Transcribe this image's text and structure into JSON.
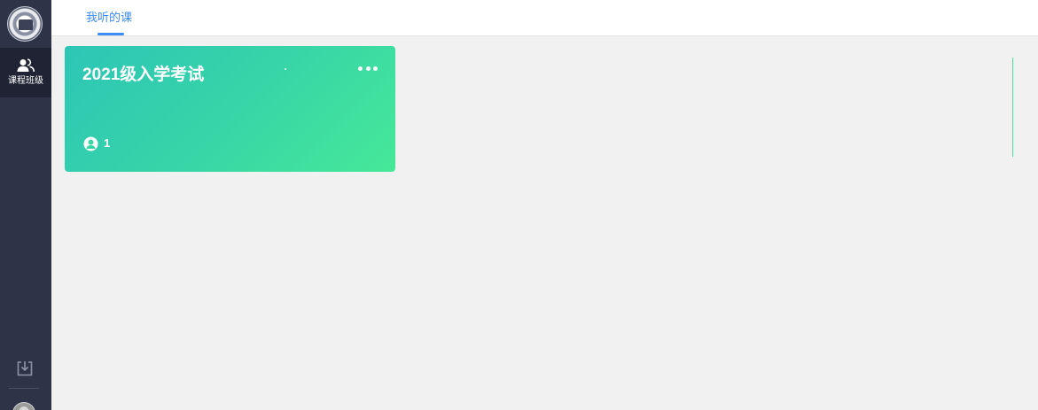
{
  "sidebar": {
    "logo_icon": "university-seal-icon",
    "nav_items": [
      {
        "label": "课程班级",
        "icon": "users-icon",
        "active": true
      }
    ],
    "bottom_icons": [
      "download-icon",
      "avatar"
    ]
  },
  "header": {
    "tabs": [
      {
        "label": "我听的课",
        "active": true
      }
    ]
  },
  "courses": [
    {
      "title": "2021级入学考试",
      "member_count": "1",
      "menu_icon": "more-icon",
      "member_icon": "person-circle-icon"
    }
  ],
  "colors": {
    "sidebar_bg": "#2e3347",
    "sidebar_active_bg": "#1f2333",
    "accent_blue": "#3b8df5",
    "card_gradient_start": "#2dc6b6",
    "card_gradient_end": "#46e898",
    "page_bg": "#f1f1f1"
  }
}
